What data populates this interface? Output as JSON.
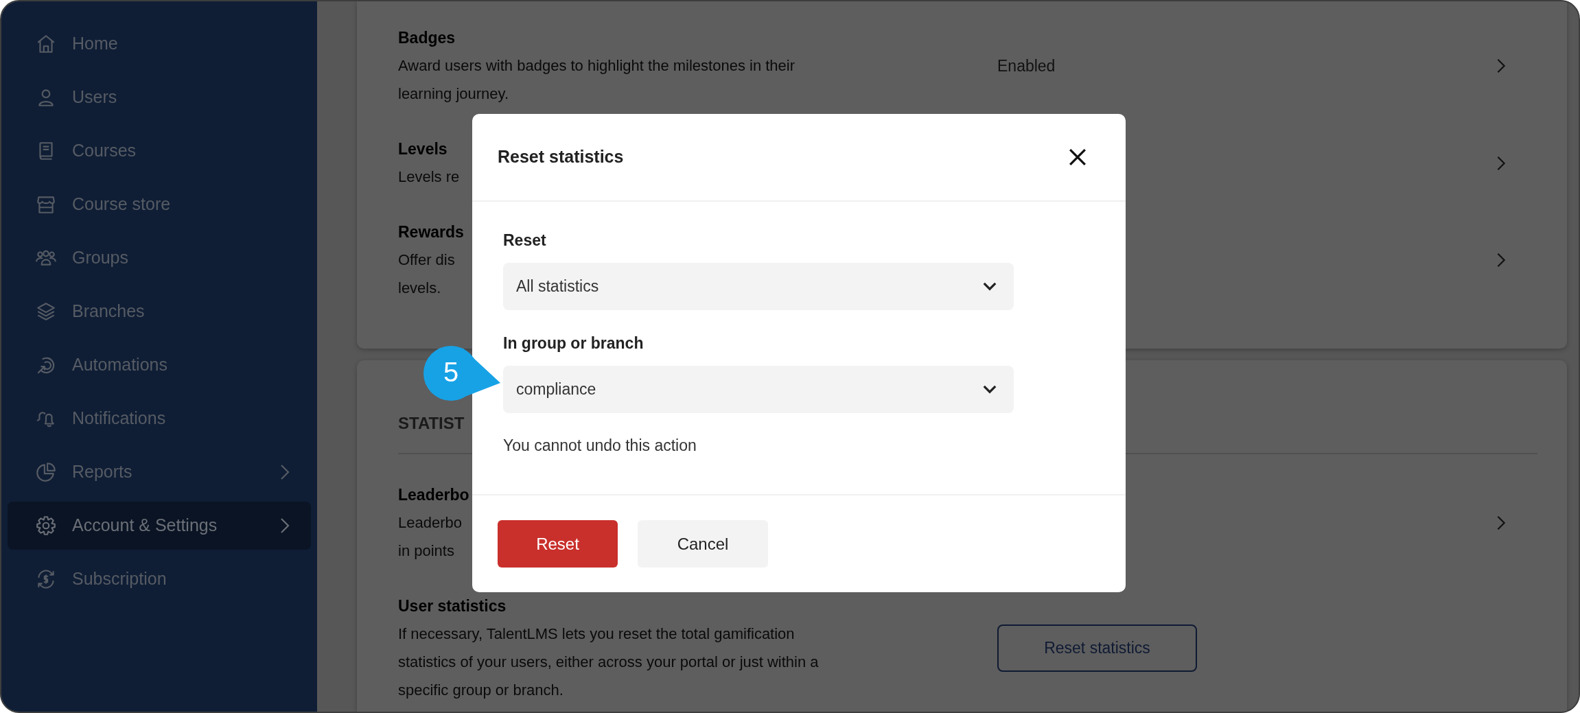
{
  "sidebar": {
    "items": [
      {
        "label": "Home",
        "selected": false,
        "expandable": false
      },
      {
        "label": "Users",
        "selected": false,
        "expandable": false
      },
      {
        "label": "Courses",
        "selected": false,
        "expandable": false
      },
      {
        "label": "Course store",
        "selected": false,
        "expandable": false
      },
      {
        "label": "Groups",
        "selected": false,
        "expandable": false
      },
      {
        "label": "Branches",
        "selected": false,
        "expandable": false
      },
      {
        "label": "Automations",
        "selected": false,
        "expandable": false
      },
      {
        "label": "Notifications",
        "selected": false,
        "expandable": false
      },
      {
        "label": "Reports",
        "selected": false,
        "expandable": true
      },
      {
        "label": "Account & Settings",
        "selected": true,
        "expandable": true
      },
      {
        "label": "Subscription",
        "selected": false,
        "expandable": false
      }
    ]
  },
  "gamification_card": {
    "rows": [
      {
        "kind": "chevron",
        "title": "Badges",
        "description": "Award users with badges to highlight the milestones in their\nlearning journey.",
        "value": "Enabled"
      },
      {
        "kind": "chevron",
        "title": "Levels",
        "description": "Levels re"
      },
      {
        "kind": "chevron",
        "title": "Rewards",
        "description": "Offer dis\nlevels."
      }
    ]
  },
  "statistics_card": {
    "heading": "STATIST",
    "rows": [
      {
        "kind": "chevron",
        "title": "Leaderbo",
        "description": "Leaderbo\nin points"
      },
      {
        "kind": "button",
        "title": "User statistics",
        "description": "If necessary, TalentLMS lets you reset the total gamification\nstatistics of your users, either across your portal or just within a\nspecific group or branch.",
        "button": "Reset statistics"
      }
    ]
  },
  "modal": {
    "title": "Reset statistics",
    "fields": [
      {
        "label": "Reset",
        "value": "All statistics"
      },
      {
        "label": "In group or branch",
        "value": "compliance"
      }
    ],
    "note": "You cannot undo this action",
    "buttons": [
      {
        "label": "Reset",
        "kind": "primary"
      },
      {
        "label": "Cancel",
        "kind": "secondary"
      }
    ]
  },
  "callout": {
    "number": "5"
  }
}
